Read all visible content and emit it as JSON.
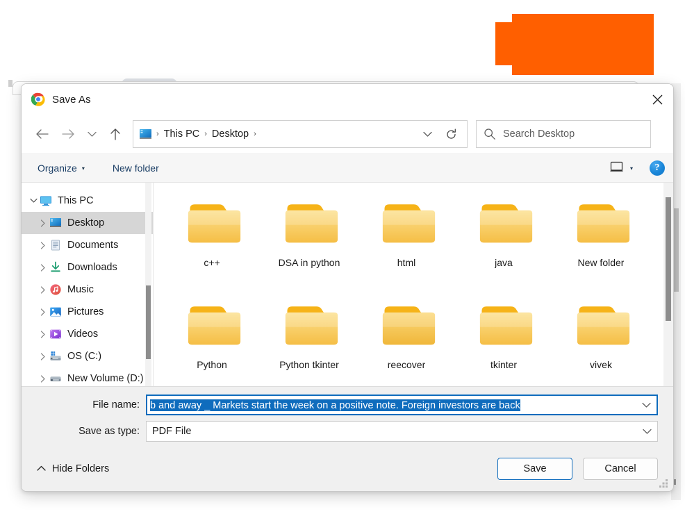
{
  "background": {
    "orange_block_color": "#FF5F00",
    "note": "redaction blocks over page content behind dialog"
  },
  "dialog": {
    "title": "Save As",
    "title_icon": "chrome-logo-icon",
    "close_icon": "close-icon"
  },
  "nav": {
    "back_icon": "arrow-left-icon",
    "forward_icon": "arrow-right-icon",
    "recent_icon": "chevron-down-icon",
    "up_icon": "arrow-up-icon",
    "breadcrumb": {
      "icon": "this-pc-icon",
      "separator": "›",
      "items": [
        "This PC",
        "Desktop"
      ],
      "trailing_separator": "›"
    },
    "address_chevron_icon": "chevron-down-icon",
    "refresh_icon": "refresh-icon",
    "search": {
      "icon": "search-icon",
      "placeholder": "Search Desktop",
      "value": ""
    }
  },
  "toolbar": {
    "organize_label": "Organize",
    "organize_caret": "▾",
    "new_folder_label": "New folder",
    "view_icon": "view-layout-icon",
    "view_caret": "▾",
    "help_label": "?"
  },
  "sidebar": {
    "items": [
      {
        "label": "This PC",
        "icon": "monitor-icon",
        "twisty": "chevron-down",
        "indent": false,
        "selected": false
      },
      {
        "label": "Desktop",
        "icon": "desktop-icon",
        "twisty": "chevron-right",
        "indent": true,
        "selected": true
      },
      {
        "label": "Documents",
        "icon": "documents-icon",
        "twisty": "chevron-right",
        "indent": true,
        "selected": false
      },
      {
        "label": "Downloads",
        "icon": "downloads-icon",
        "twisty": "chevron-right",
        "indent": true,
        "selected": false
      },
      {
        "label": "Music",
        "icon": "music-icon",
        "twisty": "chevron-right",
        "indent": true,
        "selected": false
      },
      {
        "label": "Pictures",
        "icon": "pictures-icon",
        "twisty": "chevron-right",
        "indent": true,
        "selected": false
      },
      {
        "label": "Videos",
        "icon": "videos-icon",
        "twisty": "chevron-right",
        "indent": true,
        "selected": false
      },
      {
        "label": "OS (C:)",
        "icon": "os-drive-icon",
        "twisty": "chevron-right",
        "indent": true,
        "selected": false
      },
      {
        "label": "New Volume (D:)",
        "icon": "drive-icon",
        "twisty": "chevron-right",
        "indent": true,
        "selected": false
      }
    ]
  },
  "files": {
    "items": [
      {
        "label": "c++",
        "icon": "folder-icon",
        "empty": false
      },
      {
        "label": "DSA in python",
        "icon": "folder-icon",
        "empty": false
      },
      {
        "label": "html",
        "icon": "folder-icon",
        "empty": false
      },
      {
        "label": "java",
        "icon": "folder-icon",
        "empty": false
      },
      {
        "label": "New folder",
        "icon": "folder-icon",
        "empty": false
      },
      {
        "label": "Python",
        "icon": "folder-icon",
        "empty": false
      },
      {
        "label": "Python tkinter",
        "icon": "folder-icon",
        "empty": false
      },
      {
        "label": "reecover",
        "icon": "folder-empty-icon",
        "empty": true
      },
      {
        "label": "tkinter",
        "icon": "folder-icon",
        "empty": false
      },
      {
        "label": "vivek",
        "icon": "folder-icon",
        "empty": false
      }
    ]
  },
  "form": {
    "file_name_label": "File name:",
    "file_name_value": "b and away _ Markets start the week on a positive note. Foreign investors are back",
    "file_name_chevron": "chevron-down-icon",
    "save_as_type_label": "Save as type:",
    "save_as_type_value": "PDF File",
    "save_as_type_chevron": "chevron-down-icon"
  },
  "footer": {
    "hide_folders_label": "Hide Folders",
    "hide_folders_caret": "chevron-up-icon",
    "save_label": "Save",
    "cancel_label": "Cancel",
    "resize_grip": "resize-grip-icon"
  },
  "colors": {
    "accent": "#0f6cbd",
    "selection": "#0f6cbd",
    "folder": "#F7C752",
    "orange": "#FF5F00"
  }
}
